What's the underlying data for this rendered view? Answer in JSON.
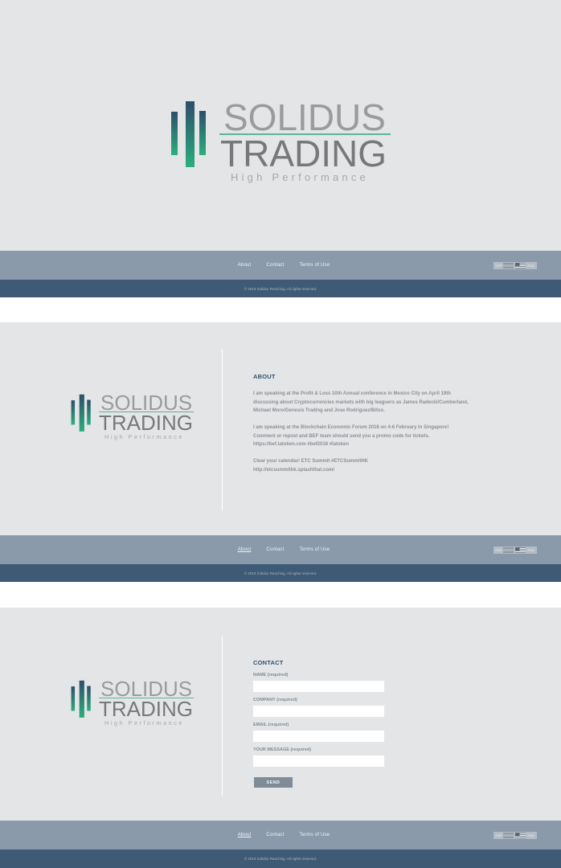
{
  "brand": {
    "name_line1": "SOLIDUS",
    "name_line2": "TRADING",
    "tagline": "High Performance"
  },
  "nav": {
    "links": [
      "About",
      "Contact",
      "Terms of Use"
    ],
    "language_left": "ESP",
    "language_right": "ENG"
  },
  "footer": {
    "copyright": "© 2018 Solidus Reaching. All rights reserved."
  },
  "about": {
    "heading": "ABOUT",
    "paragraphs": [
      "I am speaking at the Profit & Loss 10th Annual conference in Mexico City on April 19th discussing about Cryptocurrencies markets with big leaguers as James Radecki/Cumberland, Michael Moro/Genesis Trading and Jose Rodriguez/Bitso.",
      "I am speaking at the Blockchain Economic Forum 2018 on 4-6 February in Singapore! Comment or repost and BEF team should send you a promo code for tickets. https://bef.latoken.com #bef2018 #latoken",
      "Clear your calendar! ETC Summit #ETCSummitHK http://etcsummithk.splashthat.com/"
    ]
  },
  "contact": {
    "heading": "CONTACT",
    "fields": [
      {
        "label": "NAME (required)",
        "value": ""
      },
      {
        "label": "COMPANY (required)",
        "value": ""
      },
      {
        "label": "EMAIL (required)",
        "value": ""
      },
      {
        "label": "YOUR MESSAGE (required)",
        "value": ""
      }
    ],
    "submit_label": "SEND"
  },
  "colors": {
    "panel_bg": "#e4e5e7",
    "nav_bg": "#8a9aaa",
    "footer_bg": "#3e5a74",
    "accent_green": "#5bb39a",
    "heading_blue": "#2f5170"
  }
}
